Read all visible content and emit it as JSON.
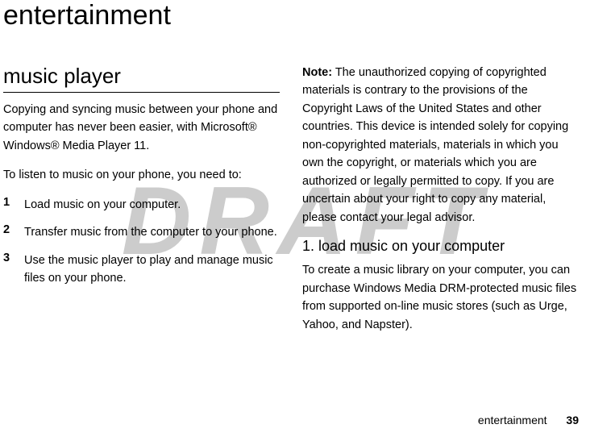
{
  "watermark": "DRAFT",
  "title": "entertainment",
  "left": {
    "heading": "music player",
    "intro": "Copying and syncing music between your phone and computer has never been easier, with Microsoft® Windows® Media Player 11.",
    "lead": "To listen to music on your phone, you need to:",
    "steps": [
      {
        "n": "1",
        "t": "Load music on your computer."
      },
      {
        "n": "2",
        "t": "Transfer music from the computer to your phone."
      },
      {
        "n": "3",
        "t": "Use the music player to play and manage music files on your phone."
      }
    ]
  },
  "right": {
    "note_label": "Note:",
    "note_text": " The unauthorized copying of copyrighted materials is contrary to the provisions of the Copyright Laws of the United States and other countries. This device is intended solely for copying non-copyrighted materials, materials in which you own the copyright, or materials which you are authorized or legally permitted to copy. If you are uncertain about your right to copy any material, please contact your legal advisor.",
    "sub2": "1. load music on your computer",
    "sub2_text": "To create a music library on your computer, you can purchase Windows Media DRM-protected music files from supported on-line music stores (such as Urge, Yahoo, and Napster)."
  },
  "footer": {
    "section": "entertainment",
    "page": "39"
  }
}
